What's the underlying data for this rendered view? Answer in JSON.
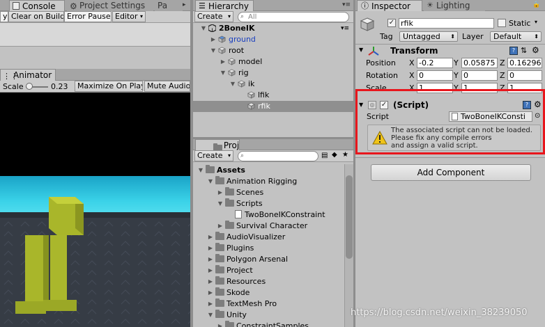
{
  "left_top": {
    "tabs": [
      "Console",
      "Project Settings",
      "Pa"
    ],
    "toolbar": [
      "y",
      "Clear on Build",
      "Error Pause",
      "Editor"
    ]
  },
  "animator": {
    "tab": "Animator",
    "scale_label": "Scale",
    "scale_value": "0.23",
    "maximize": "Maximize On Play",
    "mute": "Mute Audio"
  },
  "hierarchy": {
    "tab": "Hierarchy",
    "create": "Create",
    "search_placeholder": "All",
    "items": [
      {
        "label": "2BoneIK",
        "depth": 0,
        "arrow": "▼",
        "bold": true
      },
      {
        "label": "ground",
        "depth": 1,
        "arrow": "▶",
        "blue": true
      },
      {
        "label": "root",
        "depth": 1,
        "arrow": "▼"
      },
      {
        "label": "model",
        "depth": 2,
        "arrow": "▶"
      },
      {
        "label": "rig",
        "depth": 2,
        "arrow": "▼"
      },
      {
        "label": "ik",
        "depth": 3,
        "arrow": "▼"
      },
      {
        "label": "lfik",
        "depth": 4,
        "arrow": ""
      },
      {
        "label": "rfik",
        "depth": 4,
        "arrow": "",
        "selected": true
      }
    ]
  },
  "project": {
    "tab": "Project",
    "create": "Create",
    "items": [
      {
        "label": "Assets",
        "depth": 0,
        "arrow": "▼",
        "bold": true,
        "icon": "folder"
      },
      {
        "label": "Animation Rigging",
        "depth": 1,
        "arrow": "▼",
        "icon": "folder"
      },
      {
        "label": "Scenes",
        "depth": 2,
        "arrow": "▶",
        "icon": "folder"
      },
      {
        "label": "Scripts",
        "depth": 2,
        "arrow": "▼",
        "icon": "folder"
      },
      {
        "label": "TwoBoneIKConstraint",
        "depth": 3,
        "arrow": "",
        "icon": "cs"
      },
      {
        "label": "Survival Character",
        "depth": 2,
        "arrow": "▶",
        "icon": "folder"
      },
      {
        "label": "AudioVisualizer",
        "depth": 1,
        "arrow": "▶",
        "icon": "folder"
      },
      {
        "label": "Plugins",
        "depth": 1,
        "arrow": "▶",
        "icon": "folder"
      },
      {
        "label": "Polygon Arsenal",
        "depth": 1,
        "arrow": "▶",
        "icon": "folder"
      },
      {
        "label": "Project",
        "depth": 1,
        "arrow": "▶",
        "icon": "folder"
      },
      {
        "label": "Resources",
        "depth": 1,
        "arrow": "▶",
        "icon": "folder"
      },
      {
        "label": "Skode",
        "depth": 1,
        "arrow": "▶",
        "icon": "folder"
      },
      {
        "label": "TextMesh Pro",
        "depth": 1,
        "arrow": "▶",
        "icon": "folder"
      },
      {
        "label": "Unity",
        "depth": 1,
        "arrow": "▼",
        "icon": "folder"
      },
      {
        "label": "ConstraintSamples",
        "depth": 2,
        "arrow": "▶",
        "icon": "folder"
      }
    ]
  },
  "inspector": {
    "tabs": [
      "Inspector",
      "Lighting"
    ],
    "object_name": "rfik",
    "static_label": "Static",
    "tag_label": "Tag",
    "tag_value": "Untagged",
    "layer_label": "Layer",
    "layer_value": "Default",
    "transform": {
      "title": "Transform",
      "rows": [
        {
          "label": "Position",
          "x": "-0.2",
          "y": "0.05875",
          "z": "0.16296"
        },
        {
          "label": "Rotation",
          "x": "0",
          "y": "0",
          "z": "0"
        },
        {
          "label": "Scale",
          "x": "1",
          "y": "1",
          "z": "1"
        }
      ],
      "axes": [
        "X",
        "Y",
        "Z"
      ]
    },
    "script_component": {
      "title": "(Script)",
      "script_label": "Script",
      "script_value": "TwoBoneIKConsti",
      "warning_lines": [
        "The associated script can not be loaded.",
        "Please fix any compile errors",
        "and assign a valid script."
      ]
    },
    "add_component": "Add Component"
  },
  "watermark": "https://blog.csdn.net/weixin_38239050",
  "colors": {
    "highlight_box": "#e8161c",
    "selected_row": "#8f8f8f",
    "sky": "#3ad2e8",
    "character": "#b3c02a",
    "link_blue": "#1a3fbf"
  }
}
